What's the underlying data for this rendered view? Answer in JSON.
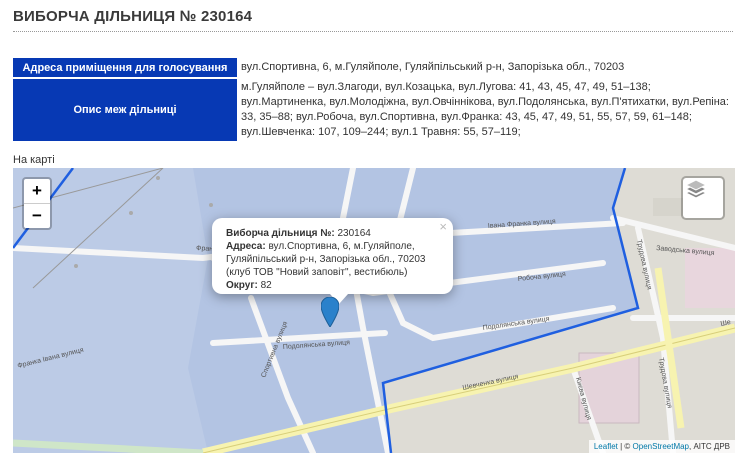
{
  "page": {
    "title": "ВИБОРЧА ДІЛЬНИЦЯ № 230164",
    "map_label": "На карті"
  },
  "info": {
    "address_label": "Адреса приміщення для голосування",
    "address_value": "вул.Спортивна, 6, м.Гуляйполе, Гуляйпільський р-н, Запорізька обл., 70203",
    "bounds_label": "Опис меж дільниці",
    "bounds_value": "м.Гуляйполе – вул.Злагоди, вул.Козацька, вул.Лугова: 41, 43, 45, 47, 49, 51–138; вул.Мартиненка, вул.Молодіжна, вул.Овчіннікова, вул.Подолянська, вул.П'ятихатки, вул.Репіна: 33, 35–88; вул.Робоча, вул.Спортивна, вул.Франка: 43, 45, 47, 49, 51, 55, 57, 59, 61–148; вул.Шевченка: 107, 109–244; вул.1 Травня: 55, 57–119;"
  },
  "map": {
    "zoom_in": "+",
    "zoom_out": "−",
    "popup": {
      "close": "×",
      "title_label": "Виборча дільниця №:",
      "title_value": "230164",
      "address_label": "Адреса:",
      "address_value": "вул.Спортивна, 6, м.Гуляйполе, Гуляйпільський р-н, Запорізька обл., 70203 (клуб ТОВ \"Новий заповіт\", вестибюль)",
      "district_label": "Округ:",
      "district_value": "82"
    },
    "streets": {
      "franka_1": "Івана Франка вулиця",
      "franka_2": "Франка вулиця",
      "franka_3": "Франка Івана вулиця",
      "robocha": "Робоча вулиця",
      "podolyanska_1": "Подолянська вулиця",
      "podolyanska_2": "Подолянська вулиця",
      "sportyvna": "Спортивна вулиця",
      "shevchenka_1": "Шевченка вулиця",
      "shevchenka_2": "Ше",
      "zavodska": "Заводська вулиця",
      "trudova_1": "Трудова вулиця",
      "trudova_2": "Трудова вулиця",
      "kyieva": "Києва вулиця"
    },
    "attribution": {
      "leaflet": "Leaflet",
      "separator": " | © ",
      "osm": "OpenStreetMap",
      "rest": ", АІТС ДРВ"
    },
    "colors": {
      "district_fill": "#b4c6e6",
      "boundary": "#1f5fe0",
      "marker": "#2a81cb"
    }
  }
}
